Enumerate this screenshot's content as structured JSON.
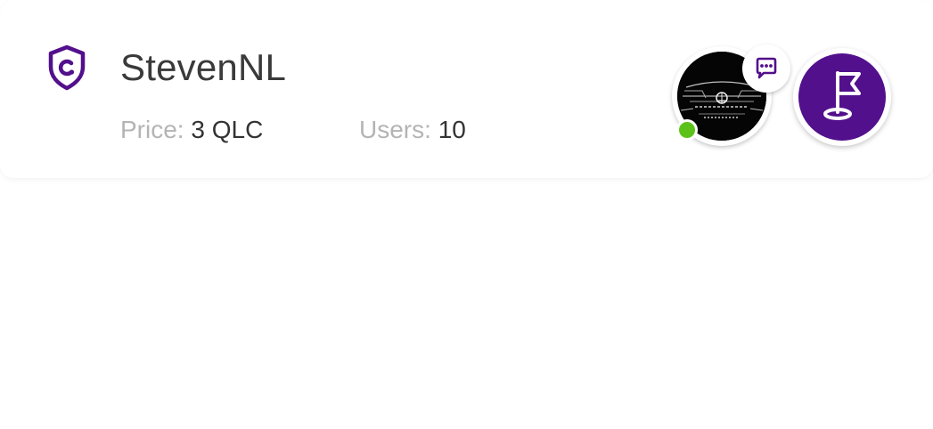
{
  "card": {
    "title": "StevenNL",
    "price_label": "Price:",
    "price_value": "3 QLC",
    "users_label": "Users:",
    "users_value": "10",
    "title_icon": "shield-icon"
  },
  "host": {
    "avatar": "avatar-image",
    "online": true,
    "chat_icon": "chat-bubble-icon"
  },
  "actions": {
    "join_icon": "golf-flag-icon"
  },
  "colors": {
    "accent": "#52108c",
    "online": "#5cc21a",
    "title_text": "#3a3a3a",
    "label_text": "#b4b4b4"
  }
}
